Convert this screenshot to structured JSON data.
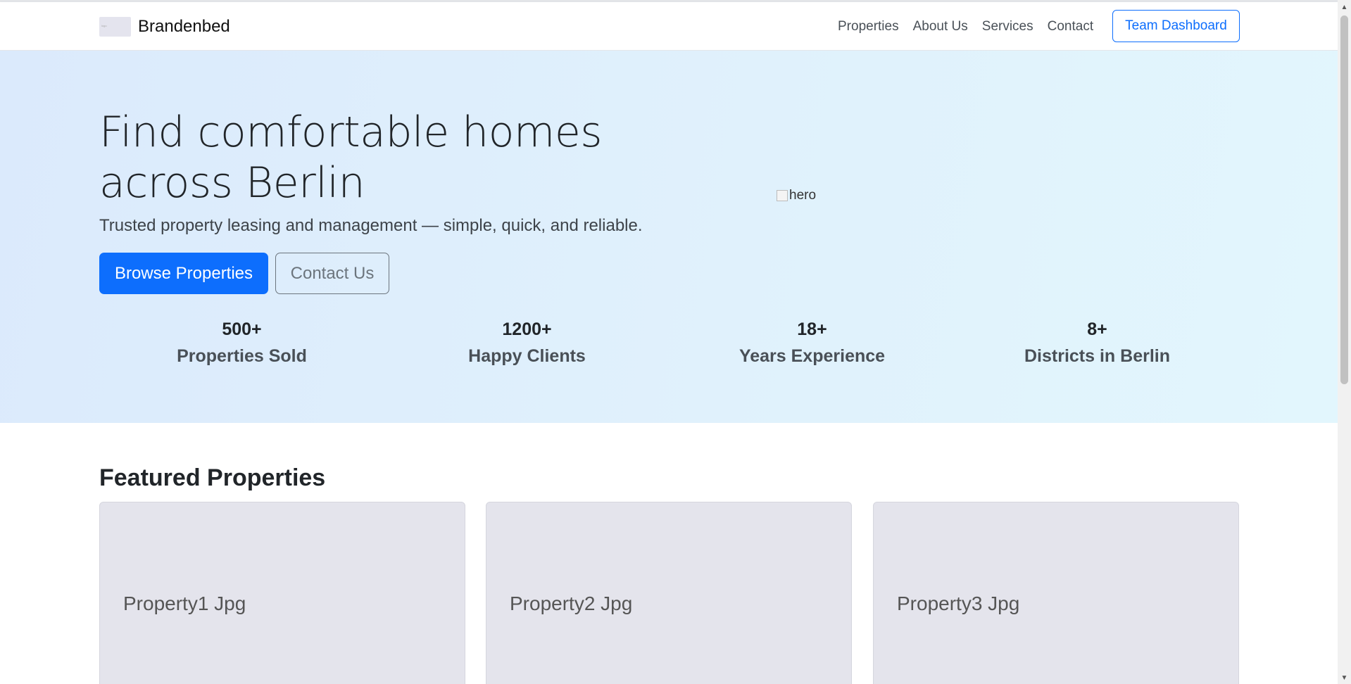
{
  "navbar": {
    "brand_name": "Brandenbed",
    "links": [
      "Properties",
      "About Us",
      "Services",
      "Contact"
    ],
    "team_button": "Team Dashboard"
  },
  "hero": {
    "title": "Find comfortable homes across Berlin",
    "subtitle": "Trusted property leasing and management — simple, quick, and reliable.",
    "primary_button": "Browse Properties",
    "secondary_button": "Contact Us",
    "image_alt": "hero",
    "stats": [
      {
        "number": "500+",
        "label": "Properties Sold"
      },
      {
        "number": "1200+",
        "label": "Happy Clients"
      },
      {
        "number": "18+",
        "label": "Years Experience"
      },
      {
        "number": "8+",
        "label": "Districts in Berlin"
      }
    ]
  },
  "featured": {
    "title": "Featured Properties",
    "cards": [
      {
        "label": "Property1 Jpg"
      },
      {
        "label": "Property2 Jpg"
      },
      {
        "label": "Property3 Jpg"
      }
    ]
  },
  "colors": {
    "primary": "#0d6efd",
    "hero_bg_start": "#dbeafc",
    "hero_bg_end": "#e2f6fd",
    "card_bg": "#e4e4ec"
  },
  "icons": {
    "scroll_up": "triangle-up-icon",
    "scroll_down": "triangle-down-icon",
    "hero_image": "broken-image-icon"
  }
}
